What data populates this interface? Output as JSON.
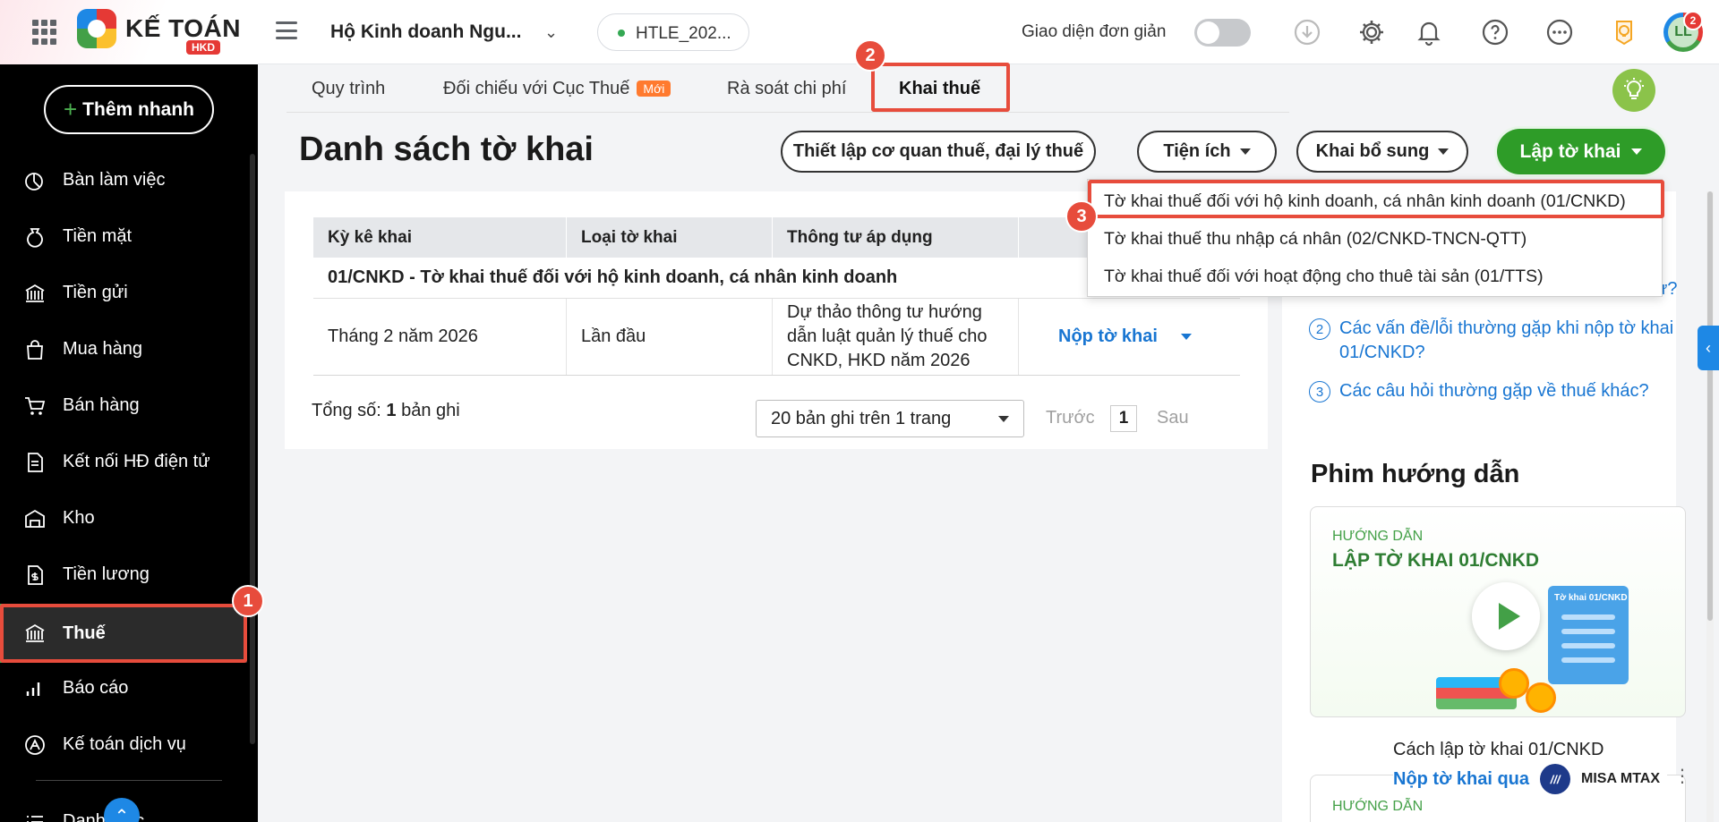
{
  "header": {
    "brand": "KẾ TOÁN",
    "brand_sub": "HKD",
    "business_name": "Hộ Kinh doanh Ngu...",
    "database": "HTLE_202...",
    "simple_mode_label": "Giao diện đơn giản",
    "avatar_initials": "LL",
    "notification_count": "2"
  },
  "sidebar": {
    "quick_add": "Thêm nhanh",
    "items": [
      {
        "label": "Bàn làm việc",
        "icon": "dashboard-icon"
      },
      {
        "label": "Tiền mặt",
        "icon": "cash-bag-icon"
      },
      {
        "label": "Tiền gửi",
        "icon": "bank-deposit-icon"
      },
      {
        "label": "Mua hàng",
        "icon": "shopping-bag-icon"
      },
      {
        "label": "Bán hàng",
        "icon": "cart-icon"
      },
      {
        "label": "Kết nối HĐ điện tử",
        "icon": "invoice-icon"
      },
      {
        "label": "Kho",
        "icon": "warehouse-icon"
      },
      {
        "label": "Tiền lương",
        "icon": "salary-icon"
      },
      {
        "label": "Thuế",
        "icon": "tax-building-icon"
      },
      {
        "label": "Báo cáo",
        "icon": "bar-chart-icon"
      },
      {
        "label": "Kế toán dịch vụ",
        "icon": "service-icon"
      },
      {
        "label": "Danh mục",
        "icon": "list-icon"
      }
    ],
    "active_index": 8
  },
  "steps": {
    "one": "1",
    "two": "2",
    "three": "3"
  },
  "tabs": [
    {
      "label": "Quy trình"
    },
    {
      "label": "Đối chiếu với Cục Thuế",
      "badge": "Mới"
    },
    {
      "label": "Rà soát chi phí"
    },
    {
      "label": "Khai thuế"
    }
  ],
  "main": {
    "title": "Danh sách tờ khai",
    "btn_setup": "Thiết lập cơ quan thuế, đại lý thuế",
    "btn_utilities": "Tiện ích",
    "btn_supplement": "Khai bổ sung",
    "btn_create": "Lập tờ khai"
  },
  "dropdown": {
    "items": [
      "Tờ khai thuế đối với hộ kinh doanh, cá nhân kinh doanh (01/CNKD)",
      "Tờ khai thuế thu nhập cá nhân (02/CNKD-TNCN-QTT)",
      "Tờ khai thuế đối với hoạt động cho thuê tài sản (01/TTS)"
    ]
  },
  "table": {
    "headers": [
      "Kỳ kê khai",
      "Loại tờ khai",
      "Thông tư áp dụng",
      ""
    ],
    "group": "01/CNKD - Tờ khai thuế đối với hộ kinh doanh, cá nhân kinh doanh",
    "rows": [
      {
        "period": "Tháng 2 năm 2026",
        "type": "Lần đầu",
        "circular": "Dự thảo thông tư hướng dẫn luật quản lý thuế cho CNKD, HKD năm 2026",
        "action": "Nộp tờ khai"
      }
    ],
    "total_label": "Tổng số:",
    "total_count": "1",
    "total_unit": "bản ghi",
    "page_size": "20 bản ghi trên 1 trang",
    "prev": "Trước",
    "page": "1",
    "next": "Sau"
  },
  "help": {
    "faq": [
      {
        "num": "2",
        "text": "Các vấn đề/lỗi thường gặp khi nộp tờ khai 01/CNKD?"
      },
      {
        "num": "3",
        "text": "Các câu hỏi thường gặp về thuế khác?"
      }
    ],
    "faq_partial_tail": "ử?",
    "videos_title": "Phim hướng dẫn",
    "video_kicker": "HƯỚNG DẪN",
    "video_heading": "LẬP TỜ KHAI 01/CNKD",
    "video_doc_label": "Tờ khai 01/CNKD",
    "video_caption": "Cách lập tờ khai 01/CNKD",
    "mtax_link": "Nộp tờ khai qua",
    "mtax_name": "MISA MTAX",
    "mtax_mark": "///",
    "video2_kicker": "HƯỚNG DẪN"
  }
}
